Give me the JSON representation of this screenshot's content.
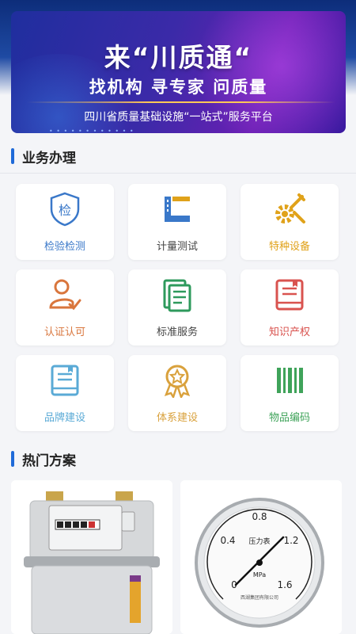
{
  "banner": {
    "title": "来“川质通“",
    "subtitle": "找机构  寻专家  问质量",
    "tagline": "四川省质量基础设施“一站式”服务平台",
    "dots": "• • • • • • • • • • • •"
  },
  "services": {
    "title": "业务办理",
    "items": [
      {
        "label": "检验检测",
        "icon": "shield-inspection-icon",
        "color": "#3a78c9"
      },
      {
        "label": "计量测试",
        "icon": "ruler-square-icon",
        "color": "#3a78c9"
      },
      {
        "label": "特种设备",
        "icon": "gear-wrench-icon",
        "color": "#e0a21a"
      },
      {
        "label": "认证认可",
        "icon": "user-certified-icon",
        "color": "#d9763d"
      },
      {
        "label": "标准服务",
        "icon": "document-stack-icon",
        "color": "#2e9a5c"
      },
      {
        "label": "知识产权",
        "icon": "book-icon",
        "color": "#d9534f"
      },
      {
        "label": "品牌建设",
        "icon": "brand-book-icon",
        "color": "#5aaad6"
      },
      {
        "label": "体系建设",
        "icon": "award-medal-icon",
        "color": "#d9a13c"
      },
      {
        "label": "物品编码",
        "icon": "barcode-icon",
        "color": "#3fa35a"
      }
    ]
  },
  "plans": {
    "title": "热门方案",
    "items": [
      {
        "name": "gas-meter-image",
        "icon": "gas-meter-icon"
      },
      {
        "name": "pressure-gauge-image",
        "icon": "pressure-gauge-icon",
        "gauge": {
          "ticks": [
            "0",
            "0.4",
            "0.8",
            "1.2",
            "1.6"
          ],
          "label": "压力表",
          "unit": "MPa",
          "maker": "西湖集团有限公司"
        }
      }
    ]
  }
}
